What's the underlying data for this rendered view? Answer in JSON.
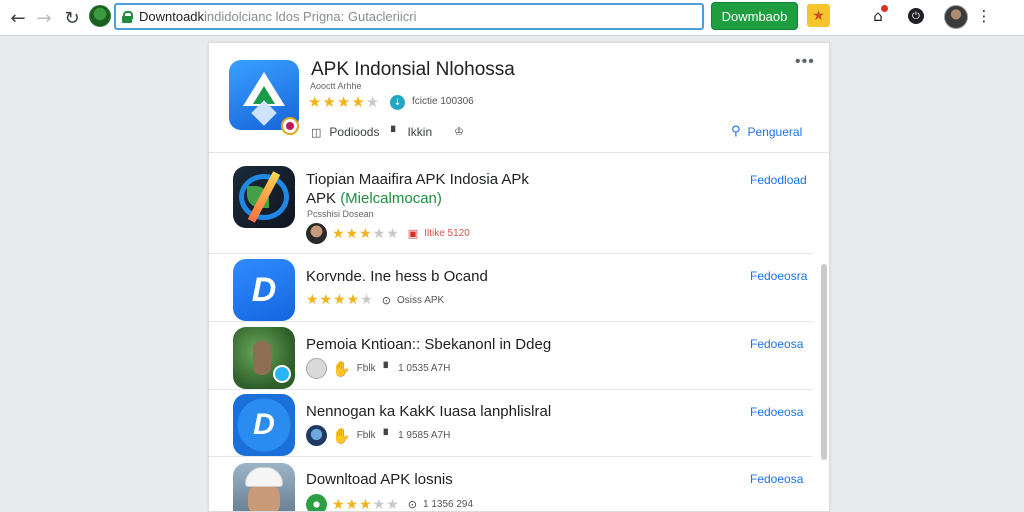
{
  "browser": {
    "back_icon": "arrow-left-icon",
    "forward_icon": "arrow-right-icon",
    "reload_icon": "reload-icon",
    "url_host": "Downtoadk",
    "url_rest": "indidolcianc ldos Prigna: Gutacleriicri",
    "download_button": "Dowmbaob",
    "colors": {
      "accent": "#1e9e3f",
      "url_border": "#4a9fd8",
      "link": "#1a73e8"
    }
  },
  "header": {
    "title": "APK Indonsial Nlohossa",
    "subtitle": "Aooctt Arhhe",
    "rating": 4,
    "downloads": "fcictie 100306",
    "actions": [
      {
        "icon": "folder-icon",
        "label": "Podioods"
      },
      {
        "icon": "chat-icon",
        "label": "Ikkin"
      },
      {
        "icon": "crown-icon",
        "label": ""
      }
    ],
    "more": "•••",
    "search_link": "Pengueral"
  },
  "items": [
    {
      "title": "Tiopian Maaifira APK Indosia APk",
      "title2_prefix": "APK ",
      "title2_green": "(Mielcalmocan)",
      "subtitle": "Pcsshisi Dosean",
      "rating": 3,
      "meta_text": "Iltike 5120",
      "link": "Fedodload"
    },
    {
      "title": "Korvnde. Ine hess b Ocand",
      "rating": 4,
      "meta_text": "Osiss  APK",
      "link": "Fedoeosra"
    },
    {
      "title": "Pemoia Kntioan:: Sbekanonl in Ddeg",
      "meta_text": "Fblk",
      "meta_text2": "1 0535  A7H",
      "link": "Fedoeosa"
    },
    {
      "title": "Nennogan ka KakK Iuasa lanphlislral",
      "meta_text": "Fblk",
      "meta_text2": "1 9585  A7H",
      "link": "Fedoeosa"
    },
    {
      "title": "Downltoad APK losnis",
      "rating": 3,
      "meta_text": "1 1356  294",
      "link": "Fedoeosa"
    }
  ]
}
